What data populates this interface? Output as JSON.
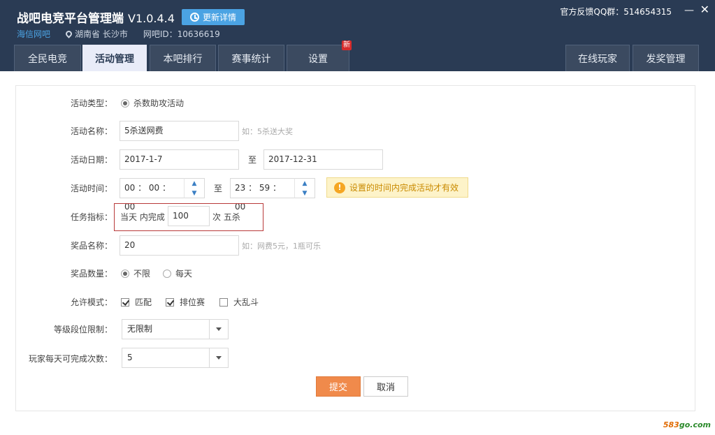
{
  "app": {
    "title": "战吧电竞平台管理端",
    "version": "V1.0.4.4",
    "update_label": "更新详情",
    "brand": "海信网吧",
    "location": "湖南省 长沙市",
    "netbar_id": "网吧ID：10636619",
    "qq_feedback": "官方反馈QQ群：514654315",
    "minimize": "—",
    "close": "✕"
  },
  "tabs": [
    {
      "label": "全民电竞"
    },
    {
      "label": "活动管理"
    },
    {
      "label": "本吧排行"
    },
    {
      "label": "赛事统计"
    },
    {
      "label": "设置"
    },
    {
      "label": "在线玩家"
    },
    {
      "label": "发奖管理"
    }
  ],
  "new_badge": "新",
  "form": {
    "type_label": "活动类型：",
    "type_option": "杀数助攻活动",
    "name_label": "活动名称：",
    "name_value": "5杀送网费",
    "name_hint": "如：5杀送大奖",
    "date_label": "活动日期：",
    "date_start": "2017-1-7",
    "date_sep": "至",
    "date_end": "2017-12-31",
    "time_label": "活动时间：",
    "time_start": "00 ： 00 ： 00",
    "time_sep": "至",
    "time_end": "23 ： 59 ： 00",
    "time_warning": "设置的时间内完成活动才有效",
    "task_label": "任务指标：",
    "task_prefix": "当天 内完成",
    "task_value": "100",
    "task_suffix": "次 五杀",
    "prize_label": "奖品名称：",
    "prize_value": "20",
    "prize_hint": "如：网费5元，1瓶可乐",
    "qty_label": "奖品数量：",
    "qty_unlimited": "不限",
    "qty_daily": "每天",
    "mode_label": "允许模式：",
    "mode_match": "匹配",
    "mode_ranked": "排位赛",
    "mode_aram": "大乱斗",
    "rank_label": "等级段位限制：",
    "rank_value": "无限制",
    "times_label": "玩家每天可完成次数：",
    "times_value": "5",
    "submit": "提交",
    "cancel": "取消"
  },
  "watermark": {
    "a": "583",
    "b": "go.com"
  }
}
